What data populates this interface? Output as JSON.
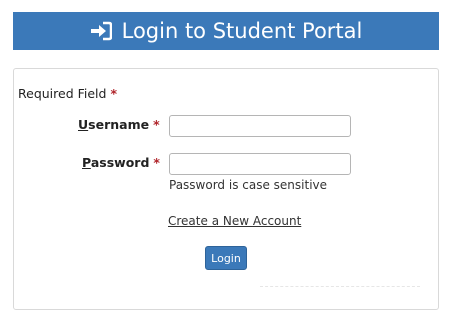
{
  "header": {
    "title": "Login to Student Portal",
    "icon": "sign-in-icon",
    "background": "#3b79b9"
  },
  "form": {
    "required_note": "Required Field",
    "required_mark": "*",
    "username": {
      "label_first": "U",
      "label_rest": "sername",
      "value": "",
      "placeholder": ""
    },
    "password": {
      "label_first": "P",
      "label_rest": "assword",
      "value": "",
      "placeholder": "",
      "hint": "Password is case sensitive"
    },
    "create_account_link": "Create a New Account",
    "login_button": "Login"
  },
  "colors": {
    "accent": "#3b79b9",
    "required_star": "#b0242a"
  }
}
